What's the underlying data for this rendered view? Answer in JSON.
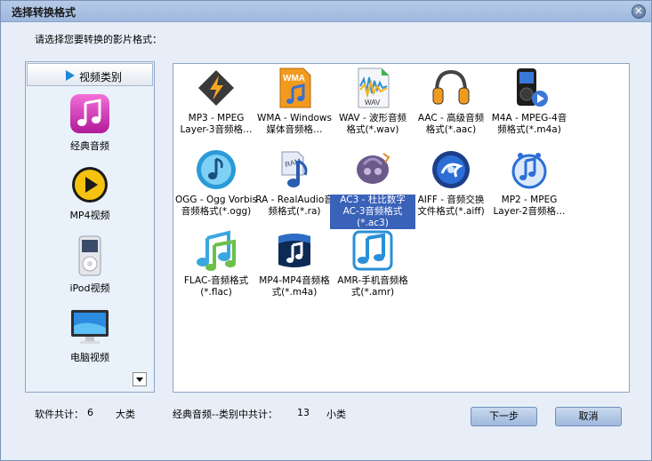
{
  "window": {
    "title": "选择转换格式",
    "close_glyph": "✕"
  },
  "prompt": "请选择您要转换的影片格式：",
  "sidebar": {
    "header": "视频类别",
    "items": [
      {
        "label": "经典音频",
        "icon": "music-note-app-icon"
      },
      {
        "label": "MP4视频",
        "icon": "play-circle-icon"
      },
      {
        "label": "iPod视频",
        "icon": "ipod-icon"
      },
      {
        "label": "电脑视频",
        "icon": "monitor-icon"
      }
    ]
  },
  "formats": [
    {
      "line1": "MP3 - MPEG",
      "line2": "Layer-3音频格…",
      "line3": "",
      "icon": "mp3-lightning-icon"
    },
    {
      "line1": "WMA - Windows",
      "line2": "媒体音频格…",
      "line3": "",
      "icon": "wma-file-icon"
    },
    {
      "line1": "WAV - 波形音频",
      "line2": "格式(*.wav)",
      "line3": "",
      "icon": "wav-file-icon"
    },
    {
      "line1": "AAC - 高级音频",
      "line2": "格式(*.aac)",
      "line3": "",
      "icon": "headphones-icon"
    },
    {
      "line1": "M4A - MPEG-4音",
      "line2": "频格式(*.m4a)",
      "line3": "",
      "icon": "media-player-icon"
    },
    {
      "line1": "OGG - Ogg Vorbis",
      "line2": "音频格式(*.ogg)",
      "line3": "",
      "icon": "ogg-disc-icon"
    },
    {
      "line1": "RA - RealAudio音",
      "line2": "频格式(*.ra)",
      "line3": "",
      "icon": "ram-note-icon"
    },
    {
      "line1": "AC3 - 杜比数字",
      "line2": "AC-3音频格式",
      "line3": "(*.ac3)",
      "icon": "ac3-icon"
    },
    {
      "line1": "AIFF - 音频交换",
      "line2": "文件格式(*.aiff)",
      "line3": "",
      "icon": "aiff-disc-icon"
    },
    {
      "line1": "MP2 - MPEG",
      "line2": "Layer-2音频格…",
      "line3": "",
      "icon": "mp2-note-icon"
    },
    {
      "line1": "FLAC-音频格式",
      "line2": "(*.flac)",
      "line3": "",
      "icon": "flac-notes-icon"
    },
    {
      "line1": "MP4-MP4音频格",
      "line2": "式(*.m4a)",
      "line3": "",
      "icon": "mp4-audio-icon"
    },
    {
      "line1": "AMR-手机音频格",
      "line2": "式(*.amr)",
      "line3": "",
      "icon": "amr-note-icon"
    }
  ],
  "selected_format": "AC3",
  "footer": {
    "software_total_label": "软件共计：",
    "software_total": "6",
    "category_unit": "大类",
    "category_label": "经典音频--类别中共计：",
    "category_total": "13",
    "subclass_unit": "小类"
  },
  "buttons": {
    "next": "下一步",
    "cancel": "取消"
  },
  "colors": {
    "selection": "#3a62b8",
    "title_bar": "#9db7dc"
  }
}
